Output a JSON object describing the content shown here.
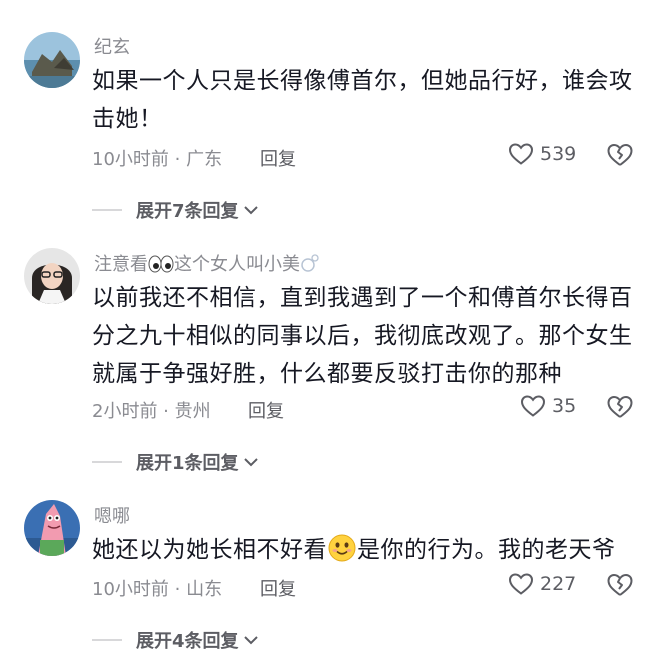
{
  "comments": [
    {
      "username": "纪玄",
      "text": "如果一个人只是长得像傅首尔，但她品行好，谁会攻击她！",
      "line1": "如果一个人只是长得像傅首尔，但她品行好，谁会攻",
      "line2": "击她！",
      "meta": "10小时前 · 广东",
      "reply": "回复",
      "likes": "539",
      "expand": "展开7条回复"
    },
    {
      "username": "注意看",
      "username_suffix": "这个女人叫小美",
      "line1": "以前我还不相信，直到我遇到了一个和傅首尔长得百",
      "line2": "分之九十相似的同事以后，我彻底改观了。那个女生",
      "line3": "就属于争强好胜，什么都要反驳打击你的那种",
      "meta": "2小时前 · 贵州",
      "reply": "回复",
      "likes": "35",
      "expand": "展开1条回复"
    },
    {
      "username": "嗯哪",
      "text_before": "她还以为她长相不好看",
      "text_after": "是你的行为。我的老天爷",
      "meta": "10小时前 · 山东",
      "reply": "回复",
      "likes": "227",
      "expand": "展开4条回复"
    }
  ],
  "icons": {
    "like": "heart-outline-icon",
    "dislike": "broken-heart-icon",
    "expand": "chevron-down-icon",
    "eyes": "eyes-emoji-icon",
    "bubbles": "bubbles-emoji-icon",
    "smile": "smiling-face-emoji-icon"
  },
  "colors": {
    "text": "#161823",
    "secondary": "#8a8b91",
    "action": "#5c5d63"
  }
}
